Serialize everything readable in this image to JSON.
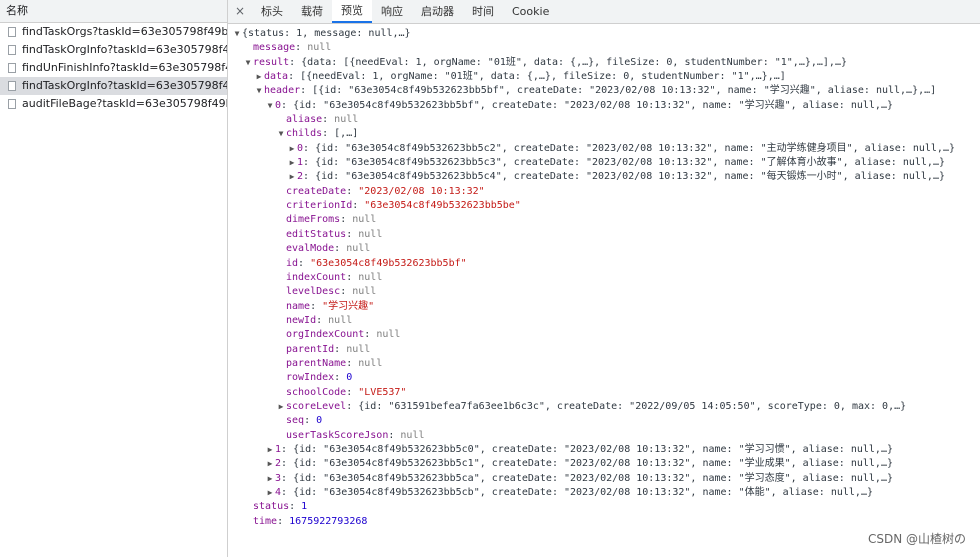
{
  "requests": {
    "header": "名称",
    "items": [
      {
        "label": "findTaskOrgs?taskId=63e305798f49b53...",
        "selected": false
      },
      {
        "label": "findTaskOrgInfo?taskId=63e305798f49b...",
        "selected": false
      },
      {
        "label": "findUnFinishInfo?taskId=63e305798f49...",
        "selected": false
      },
      {
        "label": "findTaskOrgInfo?taskId=63e305798f49b...",
        "selected": true
      },
      {
        "label": "auditFileBage?taskId=63e305798f49b53...",
        "selected": false
      }
    ]
  },
  "tabs": {
    "close": "×",
    "items": [
      "标头",
      "载荷",
      "预览",
      "响应",
      "启动器",
      "时间",
      "Cookie"
    ],
    "active_index": 2
  },
  "preview": {
    "lines": [
      {
        "indent": 0,
        "arrow": "down",
        "parts": [
          [
            "p",
            "{status: 1, message: null,…}"
          ]
        ]
      },
      {
        "indent": 1,
        "arrow": "none",
        "parts": [
          [
            "k",
            "message"
          ],
          [
            "p",
            ": "
          ],
          [
            "n",
            "null"
          ]
        ]
      },
      {
        "indent": 1,
        "arrow": "down",
        "parts": [
          [
            "k",
            "result"
          ],
          [
            "p",
            ": {data: [{needEval: 1, orgName: \"01班\", data: {,…}, fileSize: 0, studentNumber: \"1\",…},…],…}"
          ]
        ]
      },
      {
        "indent": 2,
        "arrow": "right",
        "parts": [
          [
            "k",
            "data"
          ],
          [
            "p",
            ": [{needEval: 1, orgName: \"01班\", data: {,…}, fileSize: 0, studentNumber: \"1\",…},…]"
          ]
        ]
      },
      {
        "indent": 2,
        "arrow": "down",
        "parts": [
          [
            "k",
            "header"
          ],
          [
            "p",
            ": [{id: \"63e3054c8f49b532623bb5bf\", createDate: \"2023/02/08 10:13:32\", name: \"学习兴趣\", aliase: null,…},…]"
          ]
        ]
      },
      {
        "indent": 3,
        "arrow": "down",
        "parts": [
          [
            "k",
            "0"
          ],
          [
            "p",
            ": {id: \"63e3054c8f49b532623bb5bf\", createDate: \"2023/02/08 10:13:32\", name: \"学习兴趣\", aliase: null,…}"
          ]
        ]
      },
      {
        "indent": 4,
        "arrow": "none",
        "parts": [
          [
            "k",
            "aliase"
          ],
          [
            "p",
            ": "
          ],
          [
            "n",
            "null"
          ]
        ]
      },
      {
        "indent": 4,
        "arrow": "down",
        "parts": [
          [
            "k",
            "childs"
          ],
          [
            "p",
            ": [,…]"
          ]
        ]
      },
      {
        "indent": 5,
        "arrow": "right",
        "parts": [
          [
            "k",
            "0"
          ],
          [
            "p",
            ": {id: \"63e3054c8f49b532623bb5c2\", createDate: \"2023/02/08 10:13:32\", name: \"主动学练健身项目\", aliase: null,…}"
          ]
        ]
      },
      {
        "indent": 5,
        "arrow": "right",
        "parts": [
          [
            "k",
            "1"
          ],
          [
            "p",
            ": {id: \"63e3054c8f49b532623bb5c3\", createDate: \"2023/02/08 10:13:32\", name: \"了解体育小故事\", aliase: null,…}"
          ]
        ]
      },
      {
        "indent": 5,
        "arrow": "right",
        "parts": [
          [
            "k",
            "2"
          ],
          [
            "p",
            ": {id: \"63e3054c8f49b532623bb5c4\", createDate: \"2023/02/08 10:13:32\", name: \"每天锻炼一小时\", aliase: null,…}"
          ]
        ]
      },
      {
        "indent": 4,
        "arrow": "none",
        "parts": [
          [
            "k",
            "createDate"
          ],
          [
            "p",
            ": "
          ],
          [
            "s",
            "\"2023/02/08 10:13:32\""
          ]
        ]
      },
      {
        "indent": 4,
        "arrow": "none",
        "parts": [
          [
            "k",
            "criterionId"
          ],
          [
            "p",
            ": "
          ],
          [
            "s",
            "\"63e3054c8f49b532623bb5be\""
          ]
        ]
      },
      {
        "indent": 4,
        "arrow": "none",
        "parts": [
          [
            "k",
            "dimeFroms"
          ],
          [
            "p",
            ": "
          ],
          [
            "n",
            "null"
          ]
        ]
      },
      {
        "indent": 4,
        "arrow": "none",
        "parts": [
          [
            "k",
            "editStatus"
          ],
          [
            "p",
            ": "
          ],
          [
            "n",
            "null"
          ]
        ]
      },
      {
        "indent": 4,
        "arrow": "none",
        "parts": [
          [
            "k",
            "evalMode"
          ],
          [
            "p",
            ": "
          ],
          [
            "n",
            "null"
          ]
        ]
      },
      {
        "indent": 4,
        "arrow": "none",
        "parts": [
          [
            "k",
            "id"
          ],
          [
            "p",
            ": "
          ],
          [
            "s",
            "\"63e3054c8f49b532623bb5bf\""
          ]
        ]
      },
      {
        "indent": 4,
        "arrow": "none",
        "parts": [
          [
            "k",
            "indexCount"
          ],
          [
            "p",
            ": "
          ],
          [
            "n",
            "null"
          ]
        ]
      },
      {
        "indent": 4,
        "arrow": "none",
        "parts": [
          [
            "k",
            "levelDesc"
          ],
          [
            "p",
            ": "
          ],
          [
            "n",
            "null"
          ]
        ]
      },
      {
        "indent": 4,
        "arrow": "none",
        "parts": [
          [
            "k",
            "name"
          ],
          [
            "p",
            ": "
          ],
          [
            "s",
            "\"学习兴趣\""
          ]
        ]
      },
      {
        "indent": 4,
        "arrow": "none",
        "parts": [
          [
            "k",
            "newId"
          ],
          [
            "p",
            ": "
          ],
          [
            "n",
            "null"
          ]
        ]
      },
      {
        "indent": 4,
        "arrow": "none",
        "parts": [
          [
            "k",
            "orgIndexCount"
          ],
          [
            "p",
            ": "
          ],
          [
            "n",
            "null"
          ]
        ]
      },
      {
        "indent": 4,
        "arrow": "none",
        "parts": [
          [
            "k",
            "parentId"
          ],
          [
            "p",
            ": "
          ],
          [
            "n",
            "null"
          ]
        ]
      },
      {
        "indent": 4,
        "arrow": "none",
        "parts": [
          [
            "k",
            "parentName"
          ],
          [
            "p",
            ": "
          ],
          [
            "n",
            "null"
          ]
        ]
      },
      {
        "indent": 4,
        "arrow": "none",
        "parts": [
          [
            "k",
            "rowIndex"
          ],
          [
            "p",
            ": "
          ],
          [
            "v",
            "0"
          ]
        ]
      },
      {
        "indent": 4,
        "arrow": "none",
        "parts": [
          [
            "k",
            "schoolCode"
          ],
          [
            "p",
            ": "
          ],
          [
            "s",
            "\"LVE537\""
          ]
        ]
      },
      {
        "indent": 4,
        "arrow": "right",
        "parts": [
          [
            "k",
            "scoreLevel"
          ],
          [
            "p",
            ": {id: \"631591befea7fa63ee1b6c3c\", createDate: \"2022/09/05 14:05:50\", scoreType: 0, max: 0,…}"
          ]
        ]
      },
      {
        "indent": 4,
        "arrow": "none",
        "parts": [
          [
            "k",
            "seq"
          ],
          [
            "p",
            ": "
          ],
          [
            "v",
            "0"
          ]
        ]
      },
      {
        "indent": 4,
        "arrow": "none",
        "parts": [
          [
            "k",
            "userTaskScoreJson"
          ],
          [
            "p",
            ": "
          ],
          [
            "n",
            "null"
          ]
        ]
      },
      {
        "indent": 3,
        "arrow": "right",
        "parts": [
          [
            "k",
            "1"
          ],
          [
            "p",
            ": {id: \"63e3054c8f49b532623bb5c0\", createDate: \"2023/02/08 10:13:32\", name: \"学习习惯\", aliase: null,…}"
          ]
        ]
      },
      {
        "indent": 3,
        "arrow": "right",
        "parts": [
          [
            "k",
            "2"
          ],
          [
            "p",
            ": {id: \"63e3054c8f49b532623bb5c1\", createDate: \"2023/02/08 10:13:32\", name: \"学业成果\", aliase: null,…}"
          ]
        ]
      },
      {
        "indent": 3,
        "arrow": "right",
        "parts": [
          [
            "k",
            "3"
          ],
          [
            "p",
            ": {id: \"63e3054c8f49b532623bb5ca\", createDate: \"2023/02/08 10:13:32\", name: \"学习态度\", aliase: null,…}"
          ]
        ]
      },
      {
        "indent": 3,
        "arrow": "right",
        "parts": [
          [
            "k",
            "4"
          ],
          [
            "p",
            ": {id: \"63e3054c8f49b532623bb5cb\", createDate: \"2023/02/08 10:13:32\", name: \"体能\", aliase: null,…}"
          ]
        ]
      },
      {
        "indent": 1,
        "arrow": "none",
        "parts": [
          [
            "k",
            "status"
          ],
          [
            "p",
            ": "
          ],
          [
            "v",
            "1"
          ]
        ]
      },
      {
        "indent": 1,
        "arrow": "none",
        "parts": [
          [
            "k",
            "time"
          ],
          [
            "p",
            ": "
          ],
          [
            "v",
            "1675922793268"
          ]
        ]
      }
    ]
  },
  "watermark": "CSDN @山楂树の"
}
